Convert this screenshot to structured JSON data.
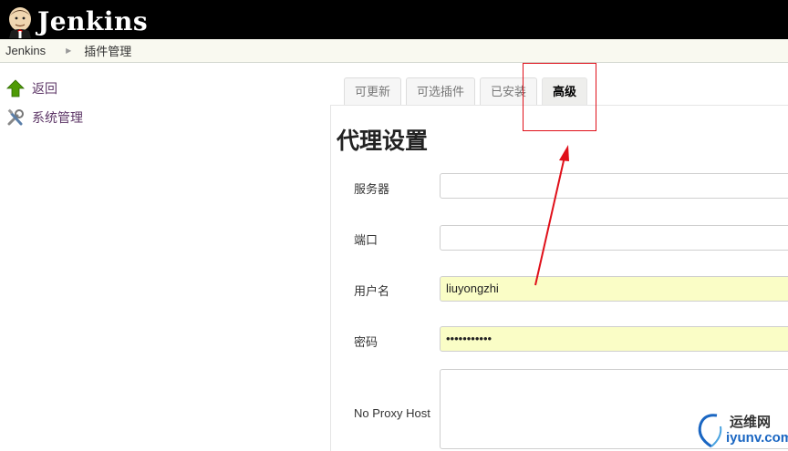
{
  "header": {
    "logo_text": "Jenkins"
  },
  "breadcrumb": {
    "items": [
      "Jenkins",
      "插件管理"
    ]
  },
  "sidebar": {
    "items": [
      {
        "label": "返回",
        "icon": "up-arrow-icon"
      },
      {
        "label": "系统管理",
        "icon": "tools-icon"
      }
    ]
  },
  "tabs": [
    {
      "label": "可更新",
      "active": false
    },
    {
      "label": "可选插件",
      "active": false
    },
    {
      "label": "已安装",
      "active": false
    },
    {
      "label": "高级",
      "active": true
    }
  ],
  "proxy": {
    "title": "代理设置",
    "fields": [
      {
        "label": "服务器",
        "value": ""
      },
      {
        "label": "端口",
        "value": ""
      },
      {
        "label": "用户名",
        "value": "liuyongzhi"
      },
      {
        "label": "密码",
        "value": "•••••••••••"
      },
      {
        "label": "No Proxy Host",
        "value": ""
      }
    ]
  },
  "watermark": {
    "cn": "运维网",
    "en": "iyunv.com"
  },
  "colors": {
    "header_bg": "#000000",
    "annotation": "#e0101a",
    "filled_field": "#fafdc6"
  }
}
